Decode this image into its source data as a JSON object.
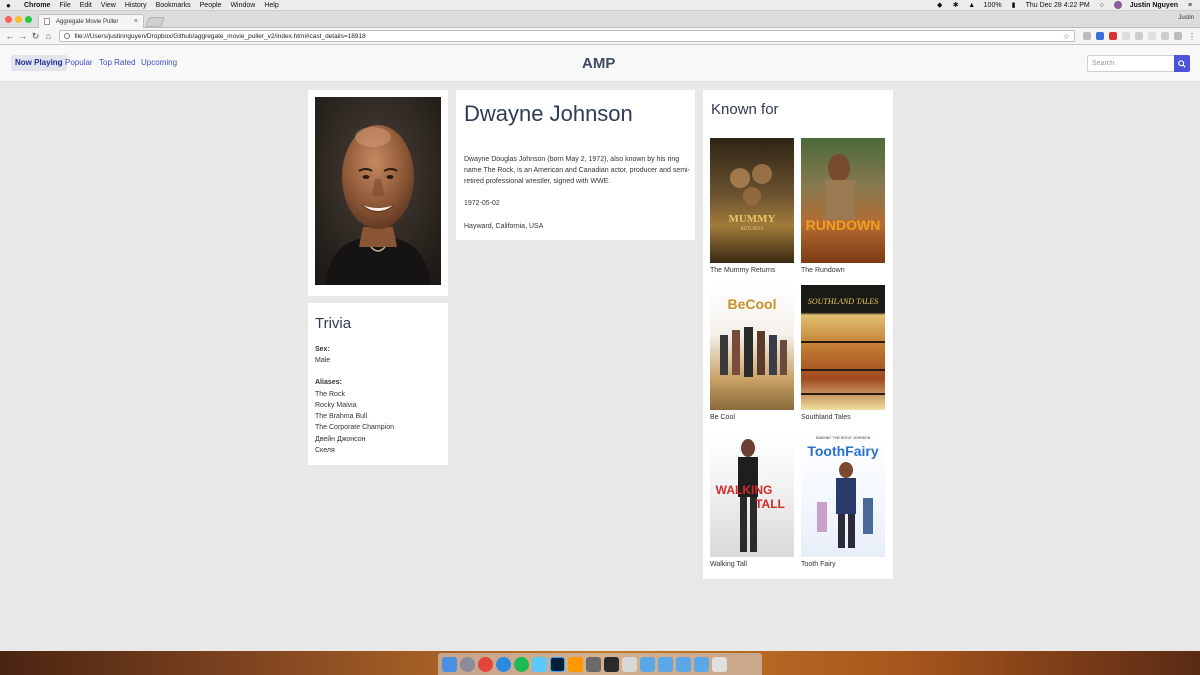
{
  "menubar": {
    "apple": "",
    "items": [
      "Chrome",
      "File",
      "Edit",
      "View",
      "History",
      "Bookmarks",
      "People",
      "Window",
      "Help"
    ],
    "battery": "100%",
    "datetime": "Thu Dec 28  4:22 PM",
    "user": "Justin Nguyen"
  },
  "browser": {
    "tab_title": "Aggregate Movie Puller",
    "tab_close": "×",
    "profile": "Justin",
    "url": "file:///Users/justinnguyen/Dropbox/Github/aggregate_movie_puller_v2/index.html#cast_details=18918"
  },
  "nav": {
    "links": [
      "Now Playing",
      "Popular",
      "Top Rated",
      "Upcoming"
    ],
    "brand": "AMP",
    "search_placeholder": "Search"
  },
  "person": {
    "name": "Dwayne Johnson",
    "bio": "Dwayne Douglas Johnson (born May 2, 1972), also known by his ring name The Rock, is an American and Canadian actor, producer and semi-retired professional wrestler, signed with WWE.",
    "birthday": "1972-05-02",
    "birthplace": "Hayward, California, USA"
  },
  "trivia": {
    "title": "Trivia",
    "sex_label": "Sex:",
    "sex_value": "Male",
    "aliases_label": "Aliases:",
    "aliases": [
      "The Rock",
      "Rocky Maivia",
      "The Brahma Bull",
      "The Corporate Champion",
      "Двейн Джонсон",
      "Скеля"
    ]
  },
  "known_for": {
    "title": "Known for",
    "movies": [
      {
        "title": "The Mummy Returns",
        "poster_text": "MUMMY",
        "poster_subtext": "RETURNS"
      },
      {
        "title": "The Rundown",
        "poster_text": "RUNDOWN",
        "poster_subtext": ""
      },
      {
        "title": "Be Cool",
        "poster_text": "BeCool",
        "poster_subtext": ""
      },
      {
        "title": "Southland Tales",
        "poster_text": "SOUTHLAND TALES",
        "poster_subtext": ""
      },
      {
        "title": "Walking Tall",
        "poster_text": "WALKING",
        "poster_subtext": "TALL"
      },
      {
        "title": "Tooth Fairy",
        "poster_text": "ToothFairy",
        "poster_subtext": "DWAYNE \"THE ROCK\" JOHNSON"
      }
    ]
  }
}
